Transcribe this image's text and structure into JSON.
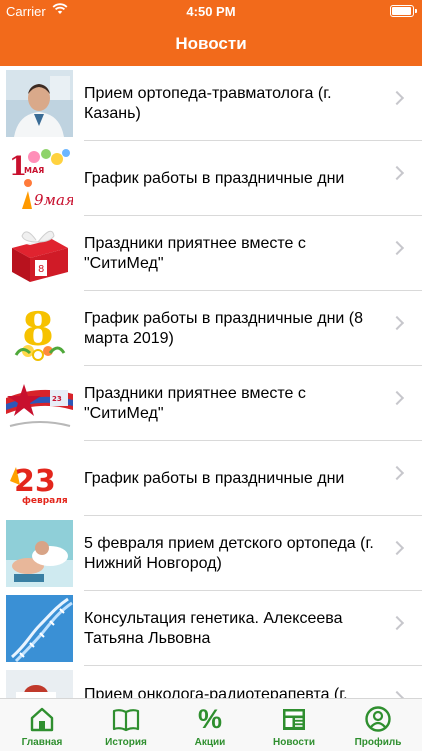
{
  "status_bar": {
    "carrier": "Carrier",
    "time": "4:50 PM",
    "battery_percent": 100
  },
  "nav": {
    "title": "Новости"
  },
  "news": [
    {
      "title": "Прием ортопеда-травматолога (г. Казань)",
      "thumb": "doctor-portrait"
    },
    {
      "title": "График работы в праздничные дни",
      "thumb": "may-holidays"
    },
    {
      "title": "Праздники приятнее вместе с \"СитиМед\"",
      "thumb": "gift-box"
    },
    {
      "title": "График работы в праздничные дни (8 марта 2019)",
      "thumb": "march-8"
    },
    {
      "title": "Праздники приятнее вместе с \"СитиМед\"",
      "thumb": "feb-23-star"
    },
    {
      "title": "График работы в праздничные дни",
      "thumb": "feb-23"
    },
    {
      "title": "5 февраля прием детского ортопеда (г. Нижний Новгород)",
      "thumb": "child-ortho"
    },
    {
      "title": "Консультация генетика. Алексеева Татьяна Львовна",
      "thumb": "dna"
    },
    {
      "title": "Прием онколога-радиотерапевта (г.",
      "thumb": "oncology"
    }
  ],
  "thumb_labels": {
    "may1_a": "1",
    "may1_b": "МАЯ",
    "may9": "9мая",
    "march8": "8",
    "feb23_num": "23",
    "feb23_word": "февраля"
  },
  "tabs": [
    {
      "label": "Главная",
      "icon": "home-icon"
    },
    {
      "label": "История",
      "icon": "book-icon"
    },
    {
      "label": "Акции",
      "icon": "percent-icon",
      "glyph": "%"
    },
    {
      "label": "Новости",
      "icon": "newspaper-icon"
    },
    {
      "label": "Профиль",
      "icon": "profile-icon"
    }
  ],
  "colors": {
    "accent": "#f26a1b",
    "tab_active": "#2f8f2f",
    "separator": "#d9d9d9"
  }
}
